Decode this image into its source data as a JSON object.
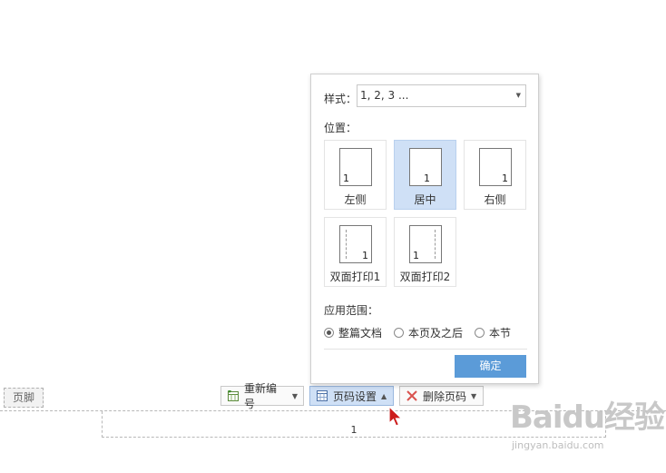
{
  "footer": {
    "label": "页脚",
    "page_number": "1"
  },
  "toolbar": {
    "renumber_label": "重新编号",
    "page_number_settings_label": "页码设置",
    "delete_label": "删除页码"
  },
  "popup": {
    "style_label": "样式：",
    "style_value": "1, 2, 3 ...",
    "position_label": "位置：",
    "positions": [
      {
        "caption": "左侧",
        "number": "1",
        "selected": false
      },
      {
        "caption": "居中",
        "number": "1",
        "selected": true
      },
      {
        "caption": "右侧",
        "number": "1",
        "selected": false
      },
      {
        "caption": "双面打印1",
        "number": "1",
        "selected": false
      },
      {
        "caption": "双面打印2",
        "number": "1",
        "selected": false
      }
    ],
    "scope_label": "应用范围：",
    "scope_options": [
      {
        "label": "整篇文档",
        "checked": true
      },
      {
        "label": "本页及之后",
        "checked": false
      },
      {
        "label": "本节",
        "checked": false
      }
    ],
    "ok_label": "确定"
  },
  "watermark": {
    "text": "Baidu经验",
    "url": "jingyan.baidu.com"
  },
  "colors": {
    "accent": "#5b9bd8",
    "selected_bg": "#cfe0f6",
    "delete_icon": "#d9534f",
    "cursor": "#cc1b1b"
  },
  "icons": [
    "renumber-icon",
    "page-number-icon",
    "delete-x-icon",
    "caret-down-icon",
    "caret-up-icon",
    "cursor-arrow-icon"
  ]
}
